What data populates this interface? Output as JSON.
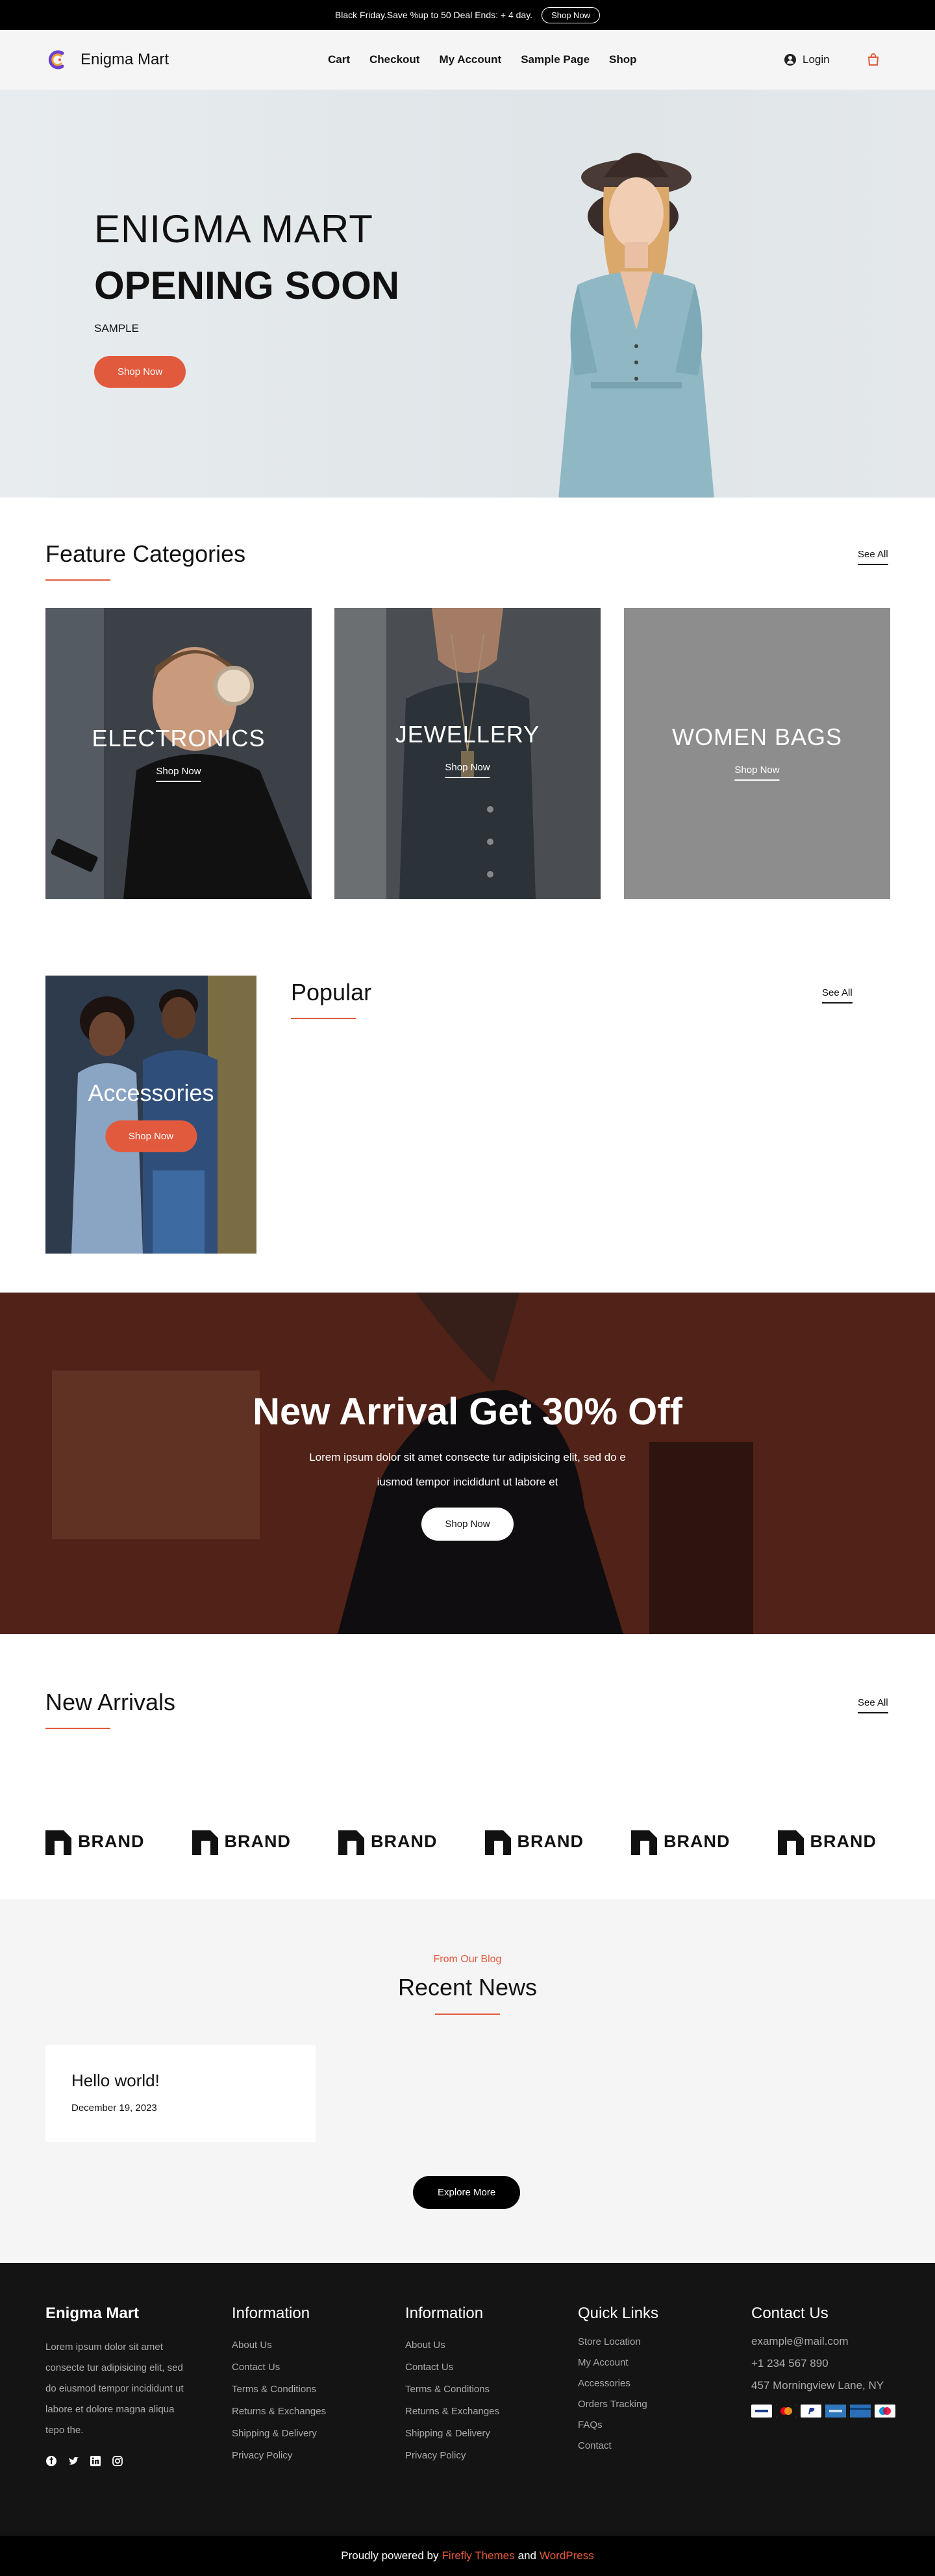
{
  "topbar": {
    "text": "Black Friday.Save %up to 50 Deal Ends: + 4 day.",
    "button": "Shop Now"
  },
  "header": {
    "brand": "Enigma Mart",
    "nav": [
      "Cart",
      "Checkout",
      "My Account",
      "Sample Page",
      "Shop"
    ],
    "login": "Login"
  },
  "hero": {
    "line1": "ENIGMA MART",
    "line2": "OPENING SOON",
    "line3": "SAMPLE",
    "button": "Shop Now"
  },
  "feature": {
    "title": "Feature Categories",
    "see_all": "See All",
    "cards": [
      {
        "title": "ELECTRONICS",
        "link": "Shop Now"
      },
      {
        "title": "JEWELLERY",
        "link": "Shop Now"
      },
      {
        "title": "WOMEN BAGS",
        "link": "Shop Now"
      }
    ]
  },
  "popular": {
    "card_title": "Accessories",
    "card_button": "Shop Now",
    "title": "Popular",
    "see_all": "See All"
  },
  "banner": {
    "title": "New Arrival Get 30% Off",
    "text1": "Lorem ipsum dolor sit amet consecte tur adipisicing elit, sed do e",
    "text2": "iusmod tempor incididunt ut labore et",
    "button": "Shop Now"
  },
  "new_arrivals": {
    "title": "New Arrivals",
    "see_all": "See All",
    "brand_label": "BRAND",
    "brand_count": 6
  },
  "blog": {
    "subtitle": "From Our Blog",
    "title": "Recent News",
    "post": {
      "title": "Hello world!",
      "date": "December 19, 2023"
    },
    "button": "Explore More"
  },
  "footer": {
    "brand": "Enigma Mart",
    "description": "Lorem ipsum dolor sit amet consecte tur adipisicing elit, sed do eiusmod tempor incididunt ut labore et dolore magna aliqua tepo the.",
    "social": [
      "facebook-icon",
      "twitter-icon",
      "linkedin-icon",
      "instagram-icon"
    ],
    "info1": {
      "title": "Information",
      "links": [
        "About Us",
        "Contact Us",
        "Terms & Conditions",
        "Returns & Exchanges",
        "Shipping & Delivery",
        "Privacy Policy"
      ]
    },
    "info2": {
      "title": "Information",
      "links": [
        "About Us",
        "Contact Us",
        "Terms & Conditions",
        "Returns & Exchanges",
        "Shipping & Delivery",
        "Privacy Policy"
      ]
    },
    "quick": {
      "title": "Quick Links",
      "links": [
        "Store Location",
        "My Account",
        "Accessories",
        "Orders Tracking",
        "FAQs",
        "Contact"
      ]
    },
    "contact": {
      "title": "Contact Us",
      "email": "example@mail.com",
      "phone": "+1 234 567 890",
      "address": "457 Morningview Lane, NY"
    },
    "payments": [
      "visa-icon",
      "mastercard-icon",
      "paypal-icon",
      "amex-icon",
      "card-icon",
      "maestro-icon"
    ]
  },
  "bottom": {
    "prefix": "Proudly powered by",
    "link1": "Firefly Themes",
    "and": "and",
    "link2": "WordPress"
  },
  "colors": {
    "accent": "#e25a3d",
    "dark": "#141414"
  }
}
